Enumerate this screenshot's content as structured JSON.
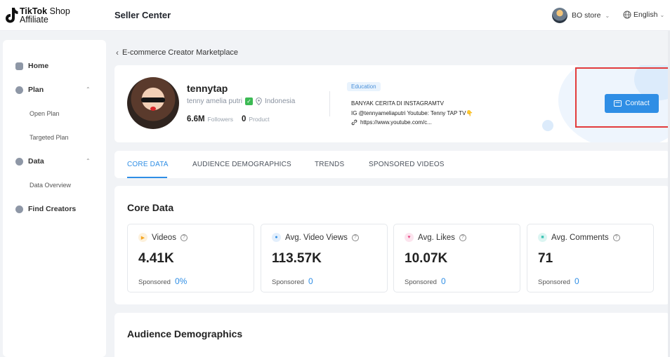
{
  "header": {
    "brand_line1_bold": "TikTok",
    "brand_line1_thin": " Shop",
    "brand_line2": "Affiliate",
    "app_title": "Seller Center",
    "store_name": "BO store",
    "language": "English"
  },
  "sidebar": {
    "items": [
      {
        "label": "Home",
        "icon": "home-icon"
      },
      {
        "label": "Plan",
        "icon": "plan-icon",
        "expanded": true
      },
      {
        "label": "Open Plan"
      },
      {
        "label": "Targeted Plan"
      },
      {
        "label": "Data",
        "icon": "data-icon",
        "expanded": true
      },
      {
        "label": "Data Overview"
      },
      {
        "label": "Find Creators",
        "icon": "find-creators-icon"
      }
    ]
  },
  "breadcrumb": "E-commerce Creator Marketplace",
  "profile": {
    "username": "tennytap",
    "full_name": "tenny amelia putri",
    "location": "Indonesia",
    "followers_value": "6.6M",
    "followers_label": "Followers",
    "product_value": "0",
    "product_label": "Product",
    "category_tag": "Education",
    "bio_line1": "BANYAK CERITA DI INSTAGRAMTV",
    "bio_line2": "IG @tennyameliaputri Youtube: Tenny TAP TV👇",
    "bio_link": "https://www.youtube.com/c...",
    "contact_label": "Contact"
  },
  "tabs": [
    "CORE DATA",
    "AUDIENCE DEMOGRAPHICS",
    "TRENDS",
    "SPONSORED VIDEOS"
  ],
  "core_data": {
    "title": "Core Data",
    "sponsored_label": "Sponsored",
    "metrics": [
      {
        "label": "Videos",
        "value": "4.41K",
        "sponsored": "0%",
        "icon": "play-icon",
        "color": "#f5a623"
      },
      {
        "label": "Avg. Video Views",
        "value": "113.57K",
        "sponsored": "0",
        "icon": "eye-icon",
        "color": "#2f8ee5"
      },
      {
        "label": "Avg. Likes",
        "value": "10.07K",
        "sponsored": "0",
        "icon": "heart-icon",
        "color": "#e94f8a"
      },
      {
        "label": "Avg. Comments",
        "value": "71",
        "sponsored": "0",
        "icon": "comment-icon",
        "color": "#3cc4b4"
      }
    ]
  },
  "audience": {
    "title": "Audience Demographics"
  },
  "colors": {
    "accent": "#2f8ee5",
    "highlight_box": "#e23b3b"
  }
}
